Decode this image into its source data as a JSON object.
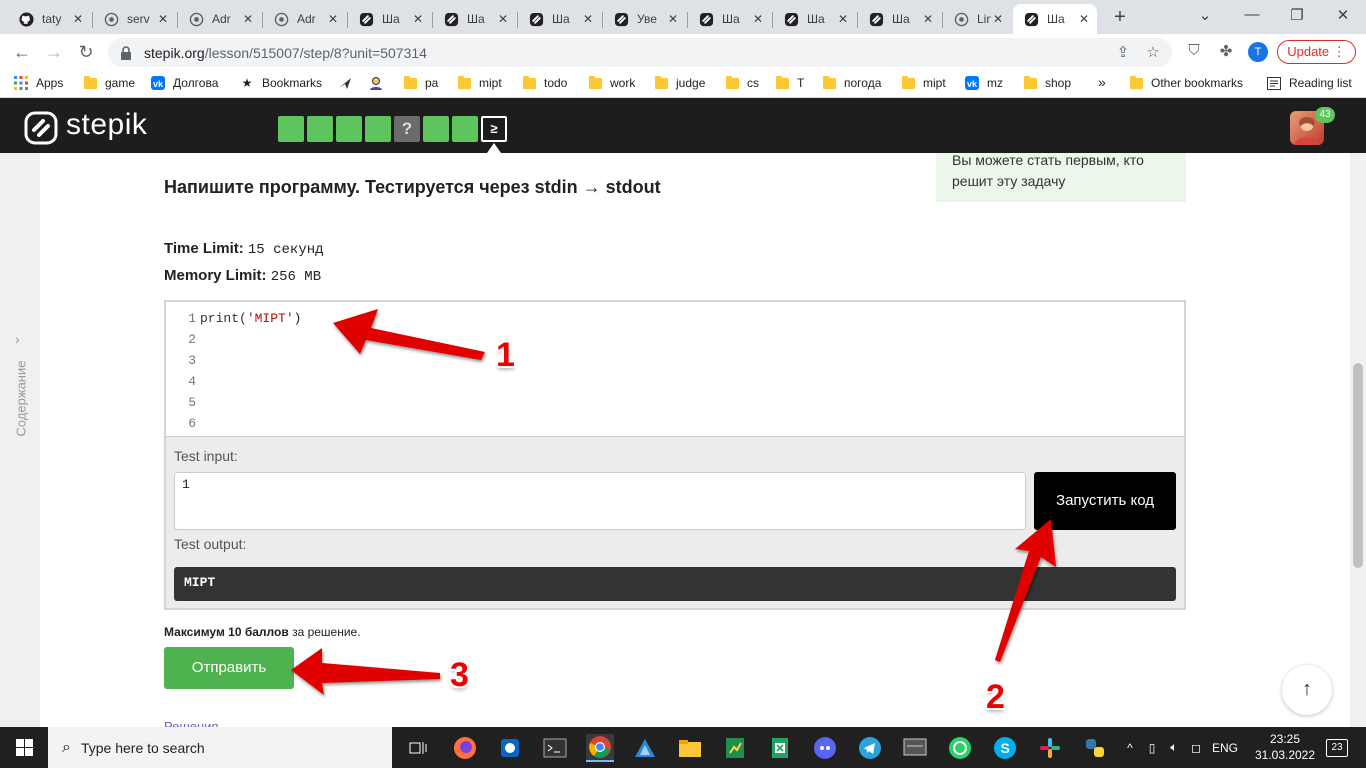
{
  "browser": {
    "tabs": [
      {
        "title": "taty",
        "icon": "github-icon"
      },
      {
        "title": "serv",
        "icon": "globe-icon"
      },
      {
        "title": "Adr",
        "icon": "globe-icon"
      },
      {
        "title": "Adr",
        "icon": "globe-icon"
      },
      {
        "title": "Ша",
        "icon": "stepik-icon"
      },
      {
        "title": "Ша",
        "icon": "stepik-icon"
      },
      {
        "title": "Ша",
        "icon": "stepik-icon"
      },
      {
        "title": "Уве",
        "icon": "stepik-icon"
      },
      {
        "title": "Ша",
        "icon": "stepik-icon"
      },
      {
        "title": "Ша",
        "icon": "stepik-icon"
      },
      {
        "title": "Ша",
        "icon": "stepik-icon"
      },
      {
        "title": "Lin",
        "icon": "globe-icon"
      },
      {
        "title": "Ша",
        "icon": "stepik-icon",
        "active": true
      }
    ],
    "new_tab": "+",
    "window_controls": [
      "⌄",
      "—",
      "❐",
      "✕"
    ],
    "url_host": "stepik.org",
    "url_path": "/lesson/515007/step/8?unit=507314",
    "profile_letter": "T",
    "update_label": "Update",
    "bookmarks": [
      {
        "label": "Apps",
        "icon": "apps-grid-icon"
      },
      {
        "label": "game",
        "icon": "folder-icon"
      },
      {
        "label": "Долгова",
        "icon": "vk-icon"
      },
      {
        "label": "Bookmarks",
        "icon": "star-icon"
      },
      {
        "label": "",
        "icon": "bird-icon"
      },
      {
        "label": "",
        "icon": "person-icon"
      },
      {
        "label": "pa",
        "icon": "folder-icon"
      },
      {
        "label": "mipt",
        "icon": "folder-icon"
      },
      {
        "label": "todo",
        "icon": "folder-icon"
      },
      {
        "label": "work",
        "icon": "folder-icon"
      },
      {
        "label": "judge",
        "icon": "folder-icon"
      },
      {
        "label": "cs",
        "icon": "folder-icon"
      },
      {
        "label": "T",
        "icon": "folder-icon"
      },
      {
        "label": "погода",
        "icon": "folder-icon"
      },
      {
        "label": "mipt",
        "icon": "folder-icon"
      },
      {
        "label": "mz",
        "icon": "vk-icon"
      },
      {
        "label": "shop",
        "icon": "folder-icon"
      }
    ],
    "bookmarks_overflow": "»",
    "other_bookmarks": "Other bookmarks",
    "reading_list": "Reading list"
  },
  "stepik": {
    "logo": "stepik",
    "steps": [
      {
        "state": "done",
        "label": ""
      },
      {
        "state": "done",
        "label": ""
      },
      {
        "state": "done",
        "label": ""
      },
      {
        "state": "done",
        "label": ""
      },
      {
        "state": "question",
        "label": "?"
      },
      {
        "state": "done",
        "label": ""
      },
      {
        "state": "done",
        "label": ""
      },
      {
        "state": "current",
        "label": "≥"
      }
    ],
    "user_badge": "43",
    "sidebar_label": "Содержание",
    "hint_line1": "Вы можете стать первым, кто",
    "hint_line2": "решит эту задачу",
    "task_title": "Напишите программу. Тестируется через stdin → stdout",
    "time_limit_label": "Time Limit:",
    "time_limit_value": "15 секунд",
    "memory_limit_label": "Memory Limit:",
    "memory_limit_value": "256 MB",
    "code": {
      "line_numbers": [
        "1",
        "2",
        "3",
        "4",
        "5",
        "6"
      ],
      "line1_fn": "print(",
      "line1_str": "'MIPT'",
      "line1_end": ")"
    },
    "test_input_label": "Test input:",
    "test_input_value": "1",
    "run_button": "Запустить код",
    "test_output_label": "Test output:",
    "test_output_value": "MIPT",
    "max_score_bold": "Максимум 10 баллов",
    "max_score_rest": " за решение.",
    "submit_button": "Отправить",
    "solutions_link": "Решения",
    "scroll_top": "↑"
  },
  "annotations": [
    "1",
    "2",
    "3"
  ],
  "taskbar": {
    "search_placeholder": "Type here to search",
    "language": "ENG",
    "time": "23:25",
    "date": "31.03.2022",
    "notifications": "23"
  }
}
